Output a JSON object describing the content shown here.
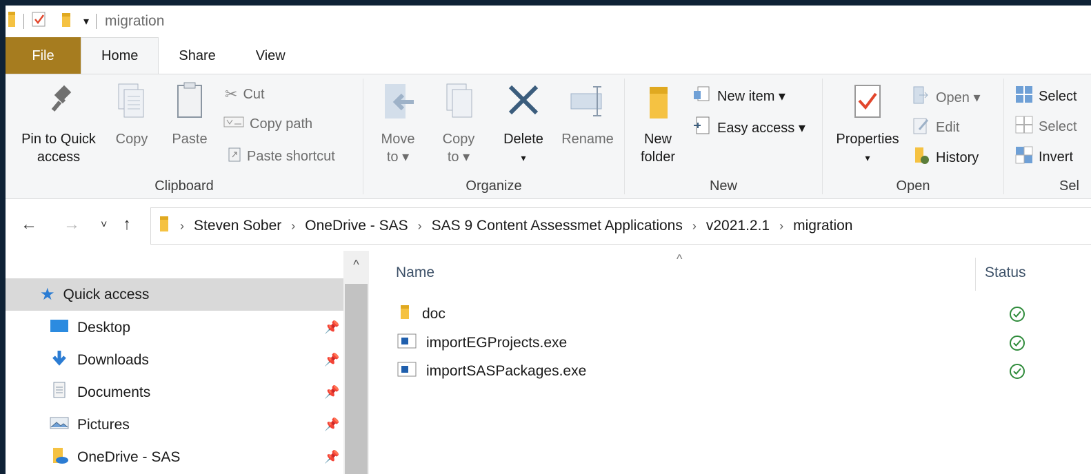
{
  "window": {
    "title": "migration",
    "quick_access_toolbar": [
      "folder-icon",
      "properties-icon",
      "new-folder-icon",
      "customize-dropdown-icon"
    ]
  },
  "tabs": {
    "file": "File",
    "home": "Home",
    "share": "Share",
    "view": "View"
  },
  "ribbon": {
    "clipboard": {
      "label": "Clipboard",
      "pin_line1": "Pin to Quick",
      "pin_line2": "access",
      "copy": "Copy",
      "paste": "Paste",
      "cut": "Cut",
      "copy_path": "Copy path",
      "paste_shortcut": "Paste shortcut"
    },
    "organize": {
      "label": "Organize",
      "move_line1": "Move",
      "move_line2": "to ▾",
      "copy_line1": "Copy",
      "copy_line2": "to ▾",
      "delete": "Delete",
      "delete_arrow": "▾",
      "rename": "Rename"
    },
    "new": {
      "label": "New",
      "new_folder_line1": "New",
      "new_folder_line2": "folder",
      "new_item": "New item ▾",
      "easy_access": "Easy access ▾"
    },
    "open": {
      "label": "Open",
      "properties": "Properties",
      "properties_arrow": "▾",
      "open": "Open ▾",
      "edit": "Edit",
      "history": "History"
    },
    "select": {
      "label": "Sel",
      "select_all": "Select",
      "select_none": "Select",
      "invert": "Invert"
    }
  },
  "address": {
    "back": "←",
    "forward": "→",
    "recent": "˅",
    "up": "↑",
    "crumbs": [
      "Steven Sober",
      "OneDrive - SAS",
      "SAS 9 Content Assessmet Applications",
      "v2021.2.1",
      "migration"
    ],
    "separator": "›"
  },
  "sidebar": {
    "scroll_up": "^",
    "items": [
      {
        "label": "Quick access",
        "icon": "star-icon",
        "pinned": false
      },
      {
        "label": "Desktop",
        "icon": "desktop-icon",
        "pinned": true
      },
      {
        "label": "Downloads",
        "icon": "download-icon",
        "pinned": true
      },
      {
        "label": "Documents",
        "icon": "documents-icon",
        "pinned": true
      },
      {
        "label": "Pictures",
        "icon": "pictures-icon",
        "pinned": true
      },
      {
        "label": "OneDrive - SAS",
        "icon": "onedrive-folder-icon",
        "pinned": true
      }
    ],
    "pin_glyph": "📌"
  },
  "filelist": {
    "sort_indicator": "^",
    "columns": {
      "name": "Name",
      "status": "Status"
    },
    "files": [
      {
        "name": "doc",
        "icon": "folder-icon",
        "status": "synced-icon"
      },
      {
        "name": "importEGProjects.exe",
        "icon": "exe-icon",
        "status": "synced-icon"
      },
      {
        "name": "importSASPackages.exe",
        "icon": "exe-icon",
        "status": "synced-icon"
      }
    ]
  },
  "colors": {
    "file_tab": "#a67c1f",
    "folder_yellow": "#f5c242",
    "status_green": "#2e8b3a",
    "blue_icon": "#2b7cd3"
  }
}
